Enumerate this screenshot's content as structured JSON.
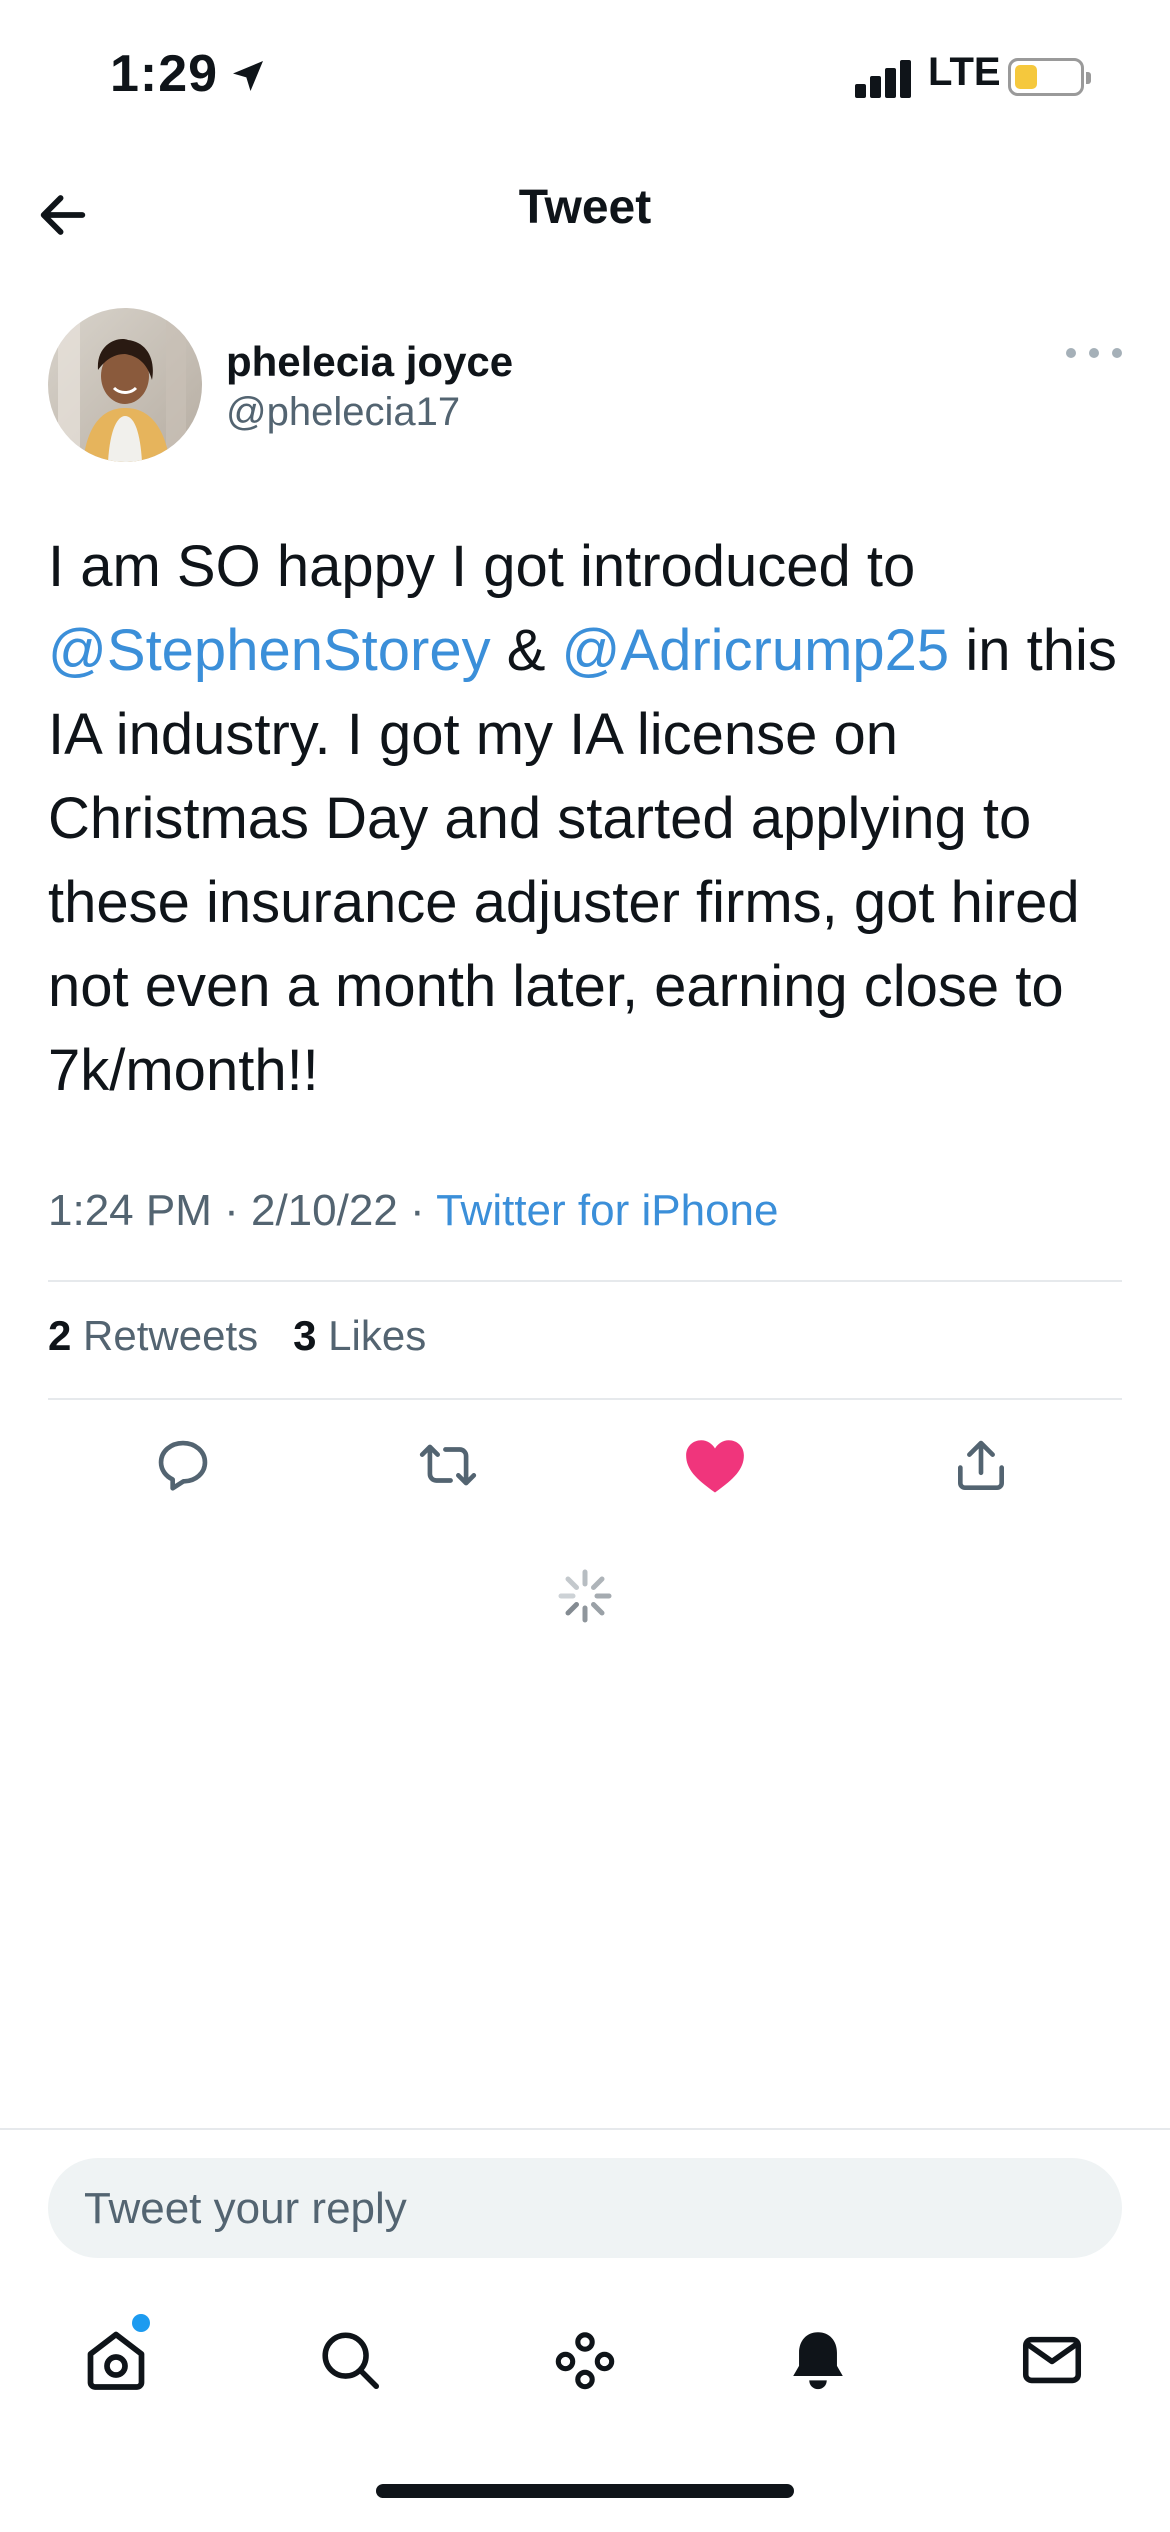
{
  "status_bar": {
    "time": "1:29",
    "network": "LTE",
    "battery_level": 0.35,
    "battery_color": "#f5c83d"
  },
  "header": {
    "title": "Tweet"
  },
  "tweet": {
    "author_name": "phelecia joyce",
    "author_handle": "@phelecia17",
    "text_part1": "I am SO happy I got introduced to ",
    "mention1": "@StephenStorey",
    "text_part2": " & ",
    "mention2": "@Adricrump25",
    "text_part3": " in this IA industry. I got my IA license on Christmas Day and started applying to these insurance adjuster firms, got hired not even a month later, earning close to 7k/month!!",
    "time": "1:24 PM",
    "date": "2/10/22",
    "separator": " · ",
    "source": "Twitter for iPhone",
    "retweets_count": "2",
    "retweets_label": "Retweets",
    "likes_count": "3",
    "likes_label": "Likes",
    "liked": true,
    "like_color": "#f0357c",
    "link_color": "#3b8fd9"
  },
  "composer": {
    "placeholder": "Tweet your reply"
  },
  "tabbar": {
    "items": [
      {
        "icon": "home-icon",
        "has_notification_dot": true
      },
      {
        "icon": "search-icon"
      },
      {
        "icon": "spaces-icon"
      },
      {
        "icon": "notifications-bell-icon"
      },
      {
        "icon": "messages-icon"
      }
    ]
  }
}
